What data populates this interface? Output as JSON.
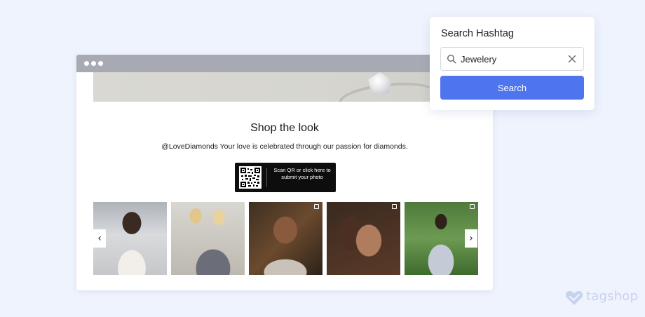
{
  "page": {
    "background": "#eef3fd"
  },
  "browser": {
    "shop_title": "Shop the look",
    "shop_subtitle": "@LoveDiamonds Your love is celebrated through our passion for diamonds.",
    "qr_button_text": "Scan QR or click here to submit your photo",
    "gallery": {
      "items": [
        {
          "name": "photo-woman-white-blouse"
        },
        {
          "name": "photo-two-women-tweed"
        },
        {
          "name": "photo-woman-glasses"
        },
        {
          "name": "photo-woman-earring"
        },
        {
          "name": "photo-woman-trench-coat"
        }
      ],
      "prev_icon": "chevron-left",
      "next_icon": "chevron-right"
    }
  },
  "search": {
    "title": "Search Hashtag",
    "input_value": "Jewelery",
    "button_label": "Search",
    "accent": "#4e74ee"
  },
  "logo": {
    "text": "tagshop",
    "color": "#c7d3ee"
  }
}
